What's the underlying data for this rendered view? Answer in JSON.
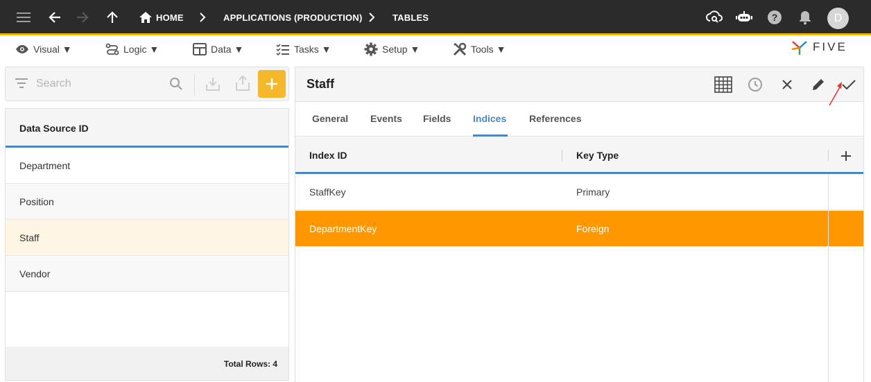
{
  "topbar": {
    "breadcrumbs": [
      "HOME",
      "APPLICATIONS (PRODUCTION)",
      "TABLES"
    ],
    "avatar_initial": "D",
    "icons": [
      "menu-icon",
      "back-arrow-icon",
      "forward-arrow-icon",
      "up-arrow-icon",
      "home-icon",
      "chevron-right-icon",
      "cloud-search-icon",
      "chat-bot-icon",
      "help-icon",
      "bell-icon"
    ]
  },
  "menubar": {
    "items": [
      {
        "label": "Visual ▼",
        "icon": "eye-icon"
      },
      {
        "label": "Logic ▼",
        "icon": "flow-icon"
      },
      {
        "label": "Data ▼",
        "icon": "table-icon"
      },
      {
        "label": "Tasks ▼",
        "icon": "checklist-icon"
      },
      {
        "label": "Setup ▼",
        "icon": "gear-icon"
      },
      {
        "label": "Tools ▼",
        "icon": "tools-icon"
      }
    ],
    "brand": "FIVE"
  },
  "left": {
    "search_placeholder": "Search",
    "column_header": "Data Source ID",
    "rows": [
      "Department",
      "Position",
      "Staff",
      "Vendor"
    ],
    "selected_row": "Staff",
    "footer": "Total Rows: 4"
  },
  "right": {
    "title": "Staff",
    "tabs": [
      "General",
      "Events",
      "Fields",
      "Indices",
      "References"
    ],
    "active_tab": "Indices",
    "columns": [
      "Index ID",
      "Key Type"
    ],
    "rows": [
      {
        "index_id": "StaffKey",
        "key_type": "Primary"
      },
      {
        "index_id": "DepartmentKey",
        "key_type": "Foreign"
      }
    ],
    "highlight_row": "DepartmentKey"
  },
  "colors": {
    "accent": "#f4b400",
    "tab_active": "#4a86c6",
    "row_highlight": "#ff9800",
    "add_button": "#f6b82b",
    "topbar": "#2b2b2b"
  }
}
